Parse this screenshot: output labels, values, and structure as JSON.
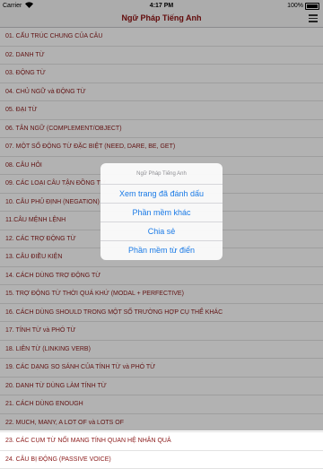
{
  "status": {
    "carrier": "Carrier",
    "time": "4:17 PM",
    "battery": "100%"
  },
  "nav": {
    "title": "Ngữ Pháp Tiếng Anh"
  },
  "items": [
    "01. CẤU TRÚC CHUNG CỦA CÂU",
    "02. DANH TỪ",
    "03. ĐỘNG TỪ",
    "04. CHỦ NGỮ và ĐỘNG TỪ",
    "05. ĐẠI TỪ",
    "06. TÂN NGỮ (COMPLEMENT/OBJECT)",
    "07. MỘT SỐ ĐỘNG TỪ ĐẶC BIỆT (NEED, DARE, BE, GET)",
    "08. CÂU HỎI",
    "09. CÁC LOẠI CÂU TẬN ĐỒNG TỪ",
    "10. CÂU PHỦ ĐỊNH (NEGATION)",
    "11.CÂU MỆNH LỆNH",
    "12. CÁC TRỢ ĐỘNG TỪ",
    "13. CÂU ĐIỀU KIỆN",
    "14. CÁCH DÙNG TRỢ ĐỘNG TỪ",
    "15. TRỢ ĐỘNG TỪ THỜI QUÁ KHỨ (MODAL + PERFECTIVE)",
    "16. CÁCH DÙNG SHOULD TRONG MỘT SỐ TRƯỜNG HỢP CỤ THỂ KHÁC",
    "17. TÍNH TỪ và PHÓ TỪ",
    "18. LIÊN TỪ (LINKING VERB)",
    "19. CÁC DẠNG SO SÁNH CỦA TÍNH TỪ và PHÓ TỪ",
    "20. DANH TỪ DÙNG LÀM TÍNH TỪ",
    "21. CÁCH DÙNG ENOUGH",
    "22. MUCH, MANY, A LOT OF và LOTS OF",
    "23. CÁC CỤM TỪ NỐI MANG TÍNH QUAN HỆ NHÂN QUẢ",
    "24. CÂU BỊ ĐỘNG (PASSIVE VOICE)"
  ],
  "sheet": {
    "title": "Ngữ Pháp Tiếng Anh",
    "options": [
      "Xem trang đã đánh dấu",
      "Phần mềm khác",
      "Chia sẻ",
      "Phần mềm từ điển"
    ]
  }
}
